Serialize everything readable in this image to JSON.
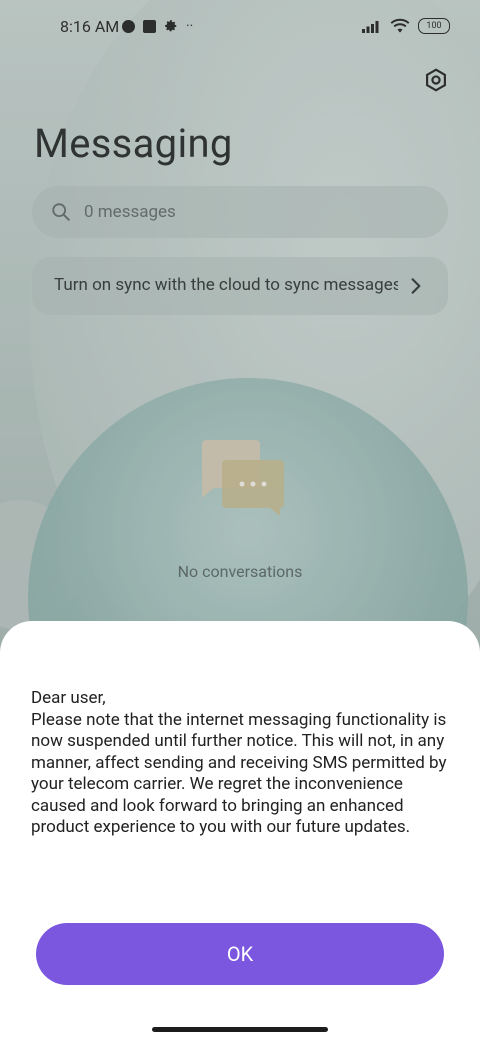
{
  "status_bar": {
    "time": "8:16 AM",
    "overflow": "··",
    "battery": "100"
  },
  "header": {
    "title": "Messaging",
    "settings_icon": "settings-icon"
  },
  "search": {
    "placeholder": "0 messages"
  },
  "sync_banner": {
    "text": "Turn on sync with the cloud to sync messages"
  },
  "empty_state": {
    "text": "No conversations"
  },
  "dialog": {
    "message": "Dear user,\nPlease note that the internet messaging functionality is now suspended until further notice. This will not, in any manner, affect sending and receiving SMS permitted by your telecom carrier. We regret the inconvenience caused and look forward to bringing an enhanced product experience to you with our future updates.",
    "ok_label": "OK"
  },
  "colors": {
    "accent": "#7b57e0",
    "sheet_bg": "#ffffff"
  }
}
